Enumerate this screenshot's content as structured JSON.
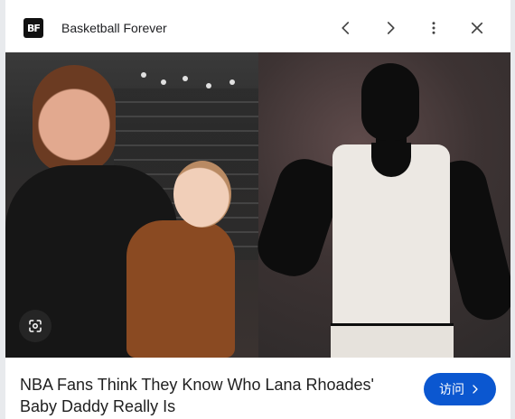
{
  "header": {
    "logo_text": "BF",
    "site_name": "Basketball Forever",
    "icons": [
      "chevron-left-icon",
      "chevron-right-icon",
      "more-vert-icon",
      "close-icon"
    ]
  },
  "image": {
    "lens_icon": "lens-icon"
  },
  "footer": {
    "title": "NBA Fans Think They Know Who Lana Rhoades' Baby Daddy Really Is",
    "visit_label": "访问",
    "visit_icon": "chevron-right-icon"
  },
  "colors": {
    "accent": "#0b57d0",
    "border": "#e8eaed",
    "text": "#1f1f1f"
  }
}
